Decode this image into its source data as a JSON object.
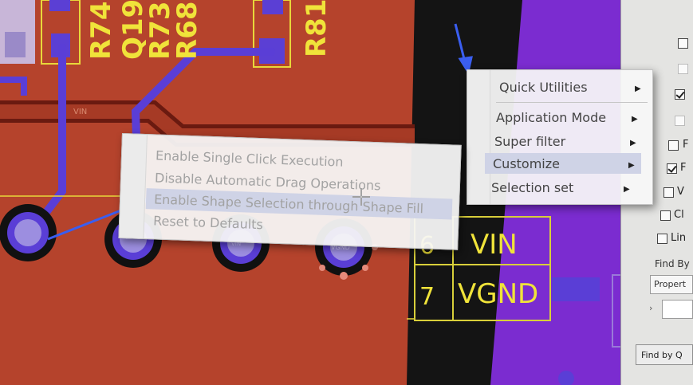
{
  "pcb": {
    "silk_vertical": [
      "R74",
      "Q19",
      "R73",
      "R68"
    ],
    "silk_right": "R81",
    "net_vin": "VIN",
    "net_vgnd": "VGND",
    "pad_label": "VGND",
    "pad_small": "VIN",
    "row_numbers": [
      "6",
      "7"
    ]
  },
  "main_menu": {
    "items": [
      {
        "label": "Quick Utilities",
        "has_submenu": true
      },
      {
        "label": "Application Mode",
        "has_submenu": true
      },
      {
        "label": "Super filter",
        "has_submenu": true
      },
      {
        "label": "Customize",
        "has_submenu": true,
        "highlighted": true
      },
      {
        "label": "Selection set",
        "has_submenu": true
      }
    ]
  },
  "customize_submenu": {
    "items": [
      {
        "label": "Enable Single Click Execution",
        "enabled": false
      },
      {
        "label": "Disable Automatic Drag Operations",
        "enabled": false
      },
      {
        "label": "Enable Shape Selection through Shape Fill",
        "enabled": false,
        "highlighted": true
      },
      {
        "label": "Reset to Defaults",
        "enabled": false
      }
    ]
  },
  "panel": {
    "checkbox_labels": [
      "F",
      "V",
      "Cl",
      "Lin"
    ],
    "find_by_label": "Find By",
    "property_select_value": "Propert",
    "find_button_label": "Find by Q"
  },
  "colors": {
    "board": "#b5432c",
    "trace": "#5a3ed6",
    "silkscreen": "#f0e33a",
    "purple_plane": "#7b2cd0",
    "menu_highlight": "#cfd3e6"
  }
}
